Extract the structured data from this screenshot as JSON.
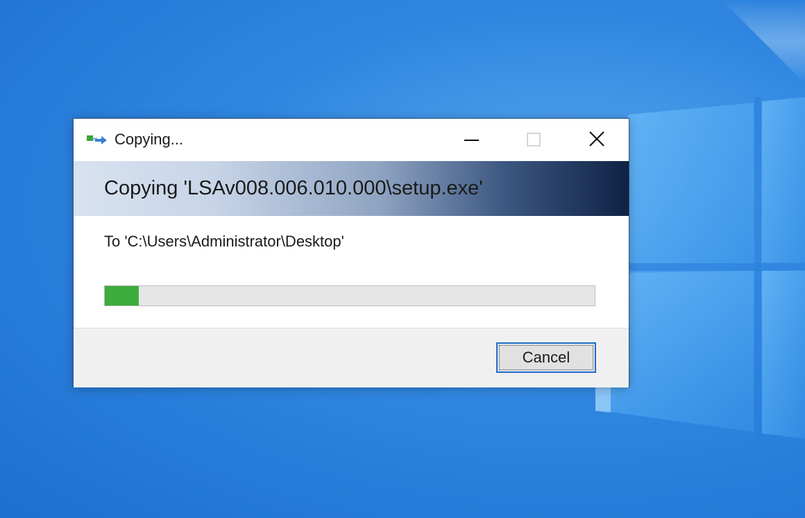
{
  "window": {
    "title": "Copying...",
    "icon": "copy-transfer-icon",
    "controls": {
      "minimize_icon": "minimize-icon",
      "maximize_icon": "maximize-icon",
      "close_icon": "close-icon"
    }
  },
  "banner": {
    "text": "Copying 'LSAv008.006.010.000\\setup.exe'"
  },
  "destination": {
    "text": "To 'C:\\Users\\Administrator\\Desktop'"
  },
  "progress": {
    "fraction": 0.07,
    "fill_color": "#3cac3c"
  },
  "footer": {
    "cancel_label": "Cancel"
  },
  "colors": {
    "desktop_blue": "#2f86e0",
    "accent_focus": "#1f6ecf",
    "banner_dark": "#0f2244"
  }
}
